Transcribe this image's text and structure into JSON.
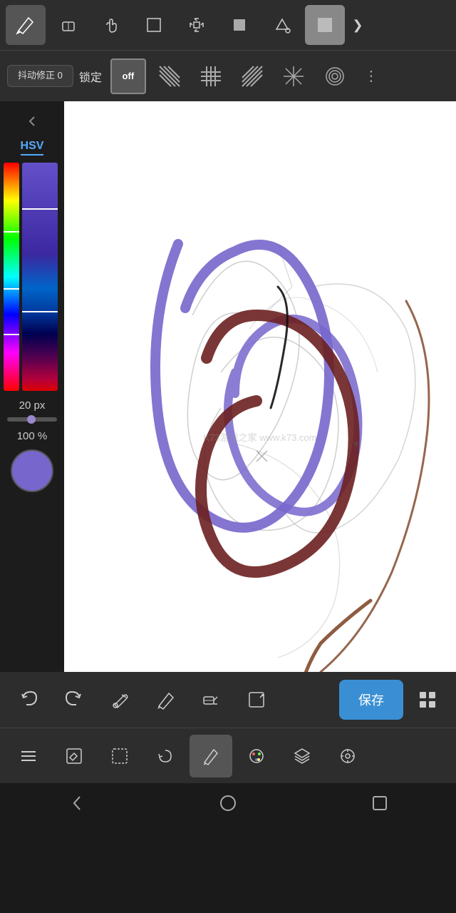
{
  "top_toolbar": {
    "tools": [
      {
        "name": "pencil",
        "icon": "✏️",
        "active": true
      },
      {
        "name": "eraser",
        "icon": "⬜",
        "active": false
      },
      {
        "name": "hand",
        "icon": "✋",
        "active": false
      },
      {
        "name": "select-rect",
        "icon": "▭",
        "active": false
      },
      {
        "name": "transform",
        "icon": "⤢",
        "active": false
      },
      {
        "name": "fill-rect",
        "icon": "■",
        "active": false
      },
      {
        "name": "fill-bucket",
        "icon": "🪣",
        "active": false
      },
      {
        "name": "color-box",
        "icon": "□",
        "active": false
      }
    ],
    "expand_label": "❯"
  },
  "stabilizer_bar": {
    "stabilizer_label": "抖动修正\n0",
    "lock_label": "锁定",
    "off_label": "off",
    "more_icon": "⋮"
  },
  "left_panel": {
    "collapse_icon": "❮",
    "hsv_label": "HSV",
    "size_label": "20 px",
    "opacity_label": "100 %"
  },
  "bottom_toolbar1": {
    "undo_icon": "↩",
    "redo_icon": "↪",
    "eyedropper_icon": "💉",
    "pen2_icon": "✒",
    "eraser_icon": "⬜",
    "export_icon": "⬜",
    "save_label": "保存",
    "grid_icon": "⊞"
  },
  "bottom_toolbar2": {
    "menu_icon": "☰",
    "edit_icon": "✎",
    "select_icon": "⬚",
    "rotate_icon": "⟳",
    "pen_icon": "✏",
    "palette_icon": "🎨",
    "layers_icon": "⧉",
    "grid2_icon": "⊛"
  },
  "nav_bar": {
    "back_icon": "◁",
    "home_icon": "○",
    "recent_icon": "□"
  },
  "watermark": "K73游戏之家\nwww.k73.com"
}
